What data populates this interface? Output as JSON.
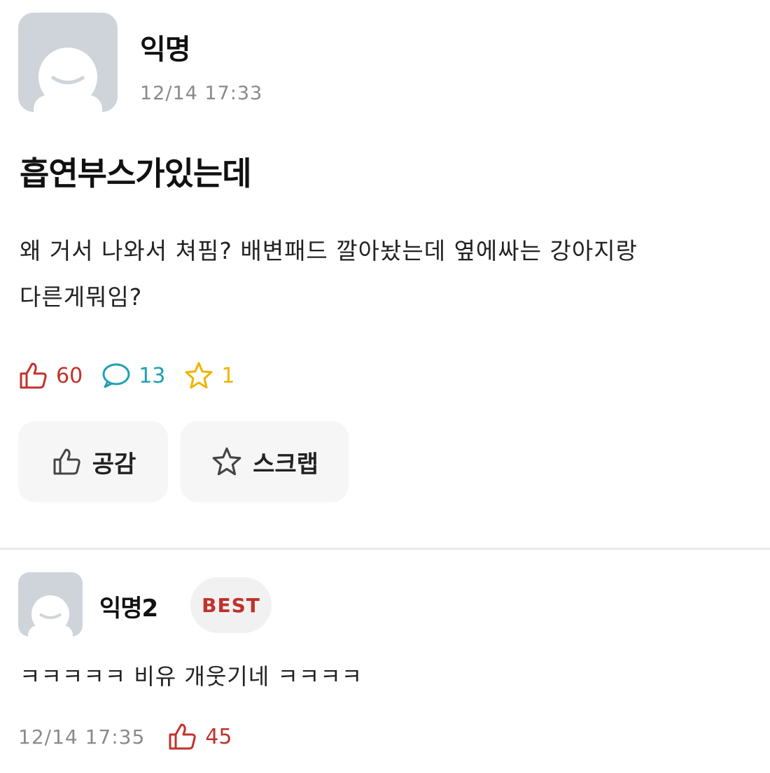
{
  "post": {
    "author": "익명",
    "timestamp": "12/14 17:33",
    "title": "흡연부스가있는데",
    "body_line1": "왜 거서 나와서 쳐핌? 배변패드 깔아놨는데 옆에싸는 강아지랑",
    "body_line2": "다른게뭐임?",
    "likes": "60",
    "comments": "13",
    "scraps": "1",
    "like_button_label": "공감",
    "scrap_button_label": "스크랩"
  },
  "comment": {
    "author": "익명2",
    "badge": "BEST",
    "text": "ㅋㅋㅋㅋㅋ 비유 개웃기네 ㅋㅋㅋㅋ",
    "timestamp": "12/14 17:35",
    "likes": "45"
  },
  "colors": {
    "like": "#c0322b",
    "comment": "#1fa0b4",
    "scrap": "#f0b400",
    "avatar": "#cfd4da"
  }
}
